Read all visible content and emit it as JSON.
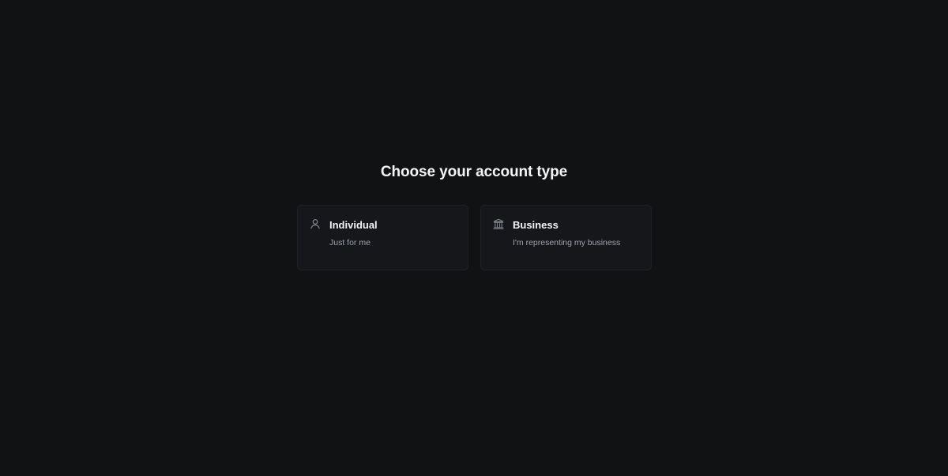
{
  "page": {
    "title": "Choose your account type"
  },
  "options": [
    {
      "id": "individual",
      "icon": "user-icon",
      "label": "Individual",
      "description": "Just for me"
    },
    {
      "id": "business",
      "icon": "bank-icon",
      "label": "Business",
      "description": "I'm representing my business"
    }
  ],
  "colors": {
    "background": "#111214",
    "card_background": "#16171b",
    "card_border": "#1f2126",
    "text_primary": "#f4f5f7",
    "text_secondary": "#9ea3ad"
  }
}
